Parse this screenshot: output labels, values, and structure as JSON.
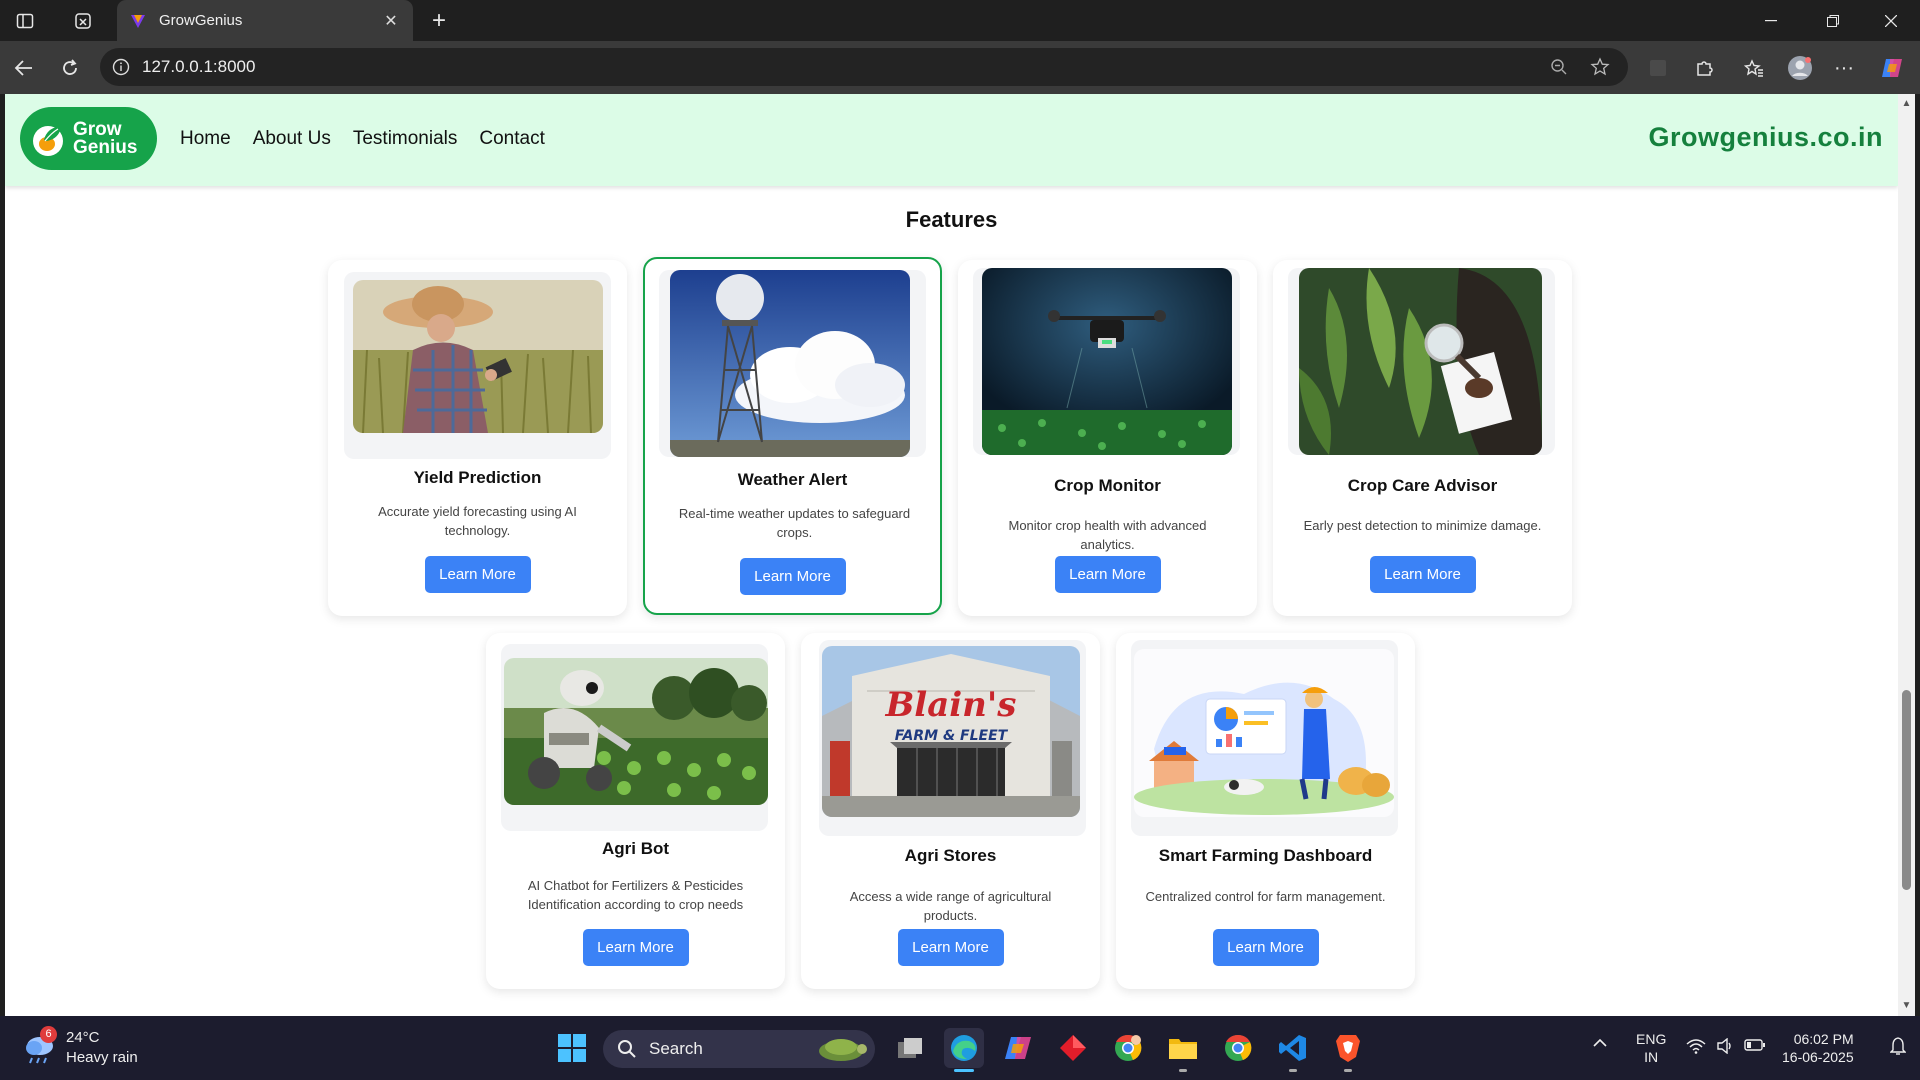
{
  "browser": {
    "tab_title": "GrowGenius",
    "url": "127.0.0.1:8000"
  },
  "site": {
    "logo_line1": "Grow",
    "logo_line2": "Genius",
    "nav": [
      "Home",
      "About Us",
      "Testimonials",
      "Contact"
    ],
    "brand_url": "Growgenius.co.in"
  },
  "features": {
    "title": "Features",
    "cards": [
      {
        "title": "Yield Prediction",
        "desc": "Accurate yield forecasting using AI technology.",
        "button": "Learn More"
      },
      {
        "title": "Weather Alert",
        "desc": "Real-time weather updates to safeguard crops.",
        "button": "Learn More"
      },
      {
        "title": "Crop Monitor",
        "desc": "Monitor crop health with advanced analytics.",
        "button": "Learn More"
      },
      {
        "title": "Crop Care Advisor",
        "desc": "Early pest detection to minimize damage.",
        "button": "Learn More"
      },
      {
        "title": "Agri Bot",
        "desc": "AI Chatbot for Fertilizers & Pesticides Identification according to crop needs",
        "button": "Learn More"
      },
      {
        "title": "Agri Stores",
        "desc": "Access a wide range of agricultural products.",
        "button": "Learn More"
      },
      {
        "title": "Smart Farming Dashboard",
        "desc": "Centralized control for farm management.",
        "button": "Learn More"
      }
    ],
    "store_sign": "Blain's",
    "store_sign_sub": "FARM & FLEET"
  },
  "taskbar": {
    "weather_temp": "24°C",
    "weather_desc": "Heavy rain",
    "weather_badge": "6",
    "search_label": "Search",
    "lang_line1": "ENG",
    "lang_line2": "IN",
    "time": "06:02 PM",
    "date": "16-06-2025"
  },
  "colors": {
    "navbar_bg": "#dcfce7",
    "brand_green": "#15803d",
    "button_blue": "#3b82f6",
    "active_border": "#16a34a"
  }
}
